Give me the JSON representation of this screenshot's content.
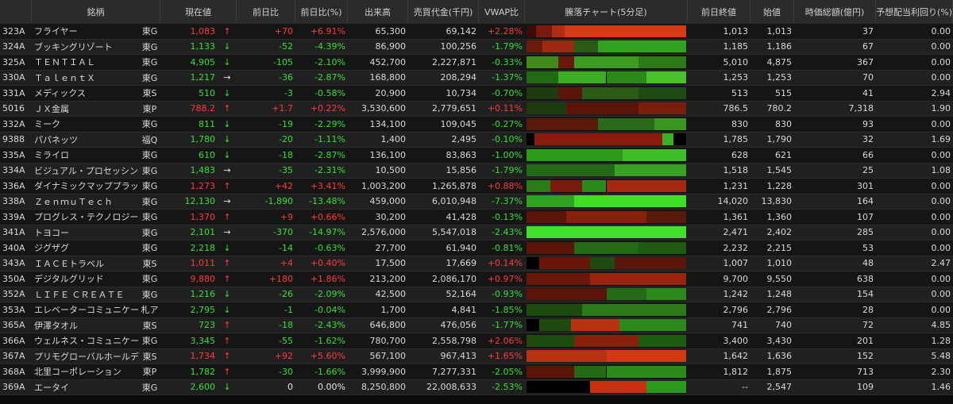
{
  "colors": {
    "up": "#ff3a3a",
    "down": "#34e034",
    "flat": "#e6e6e6"
  },
  "headers": {
    "code": "",
    "name": "銘柄",
    "market": "",
    "price": "現在値",
    "change": "前日比",
    "change_pct": "前日比(%)",
    "volume": "出来高",
    "value": "売買代金(千円)",
    "vwap": "VWAP比",
    "chart": "騰落チャート(5分足)",
    "prev_close": "前日終値",
    "open": "始値",
    "mcap": "時価総額(億円)",
    "yield": "予想配当利回り(%)"
  },
  "rows": [
    {
      "code": "323A",
      "name": "フライヤー",
      "market": "東G",
      "price": "1,083",
      "dir": "up",
      "arrow": "↑",
      "change": "+70",
      "change_pct": "+6.91%",
      "volume": "65,300",
      "value": "69,142",
      "vwap": "+2.28%",
      "prev_close": "1,013",
      "open": "1,013",
      "mcap": "37",
      "yield": "0.00",
      "chart": [
        [
          0,
          0.06,
          "#3b0c07"
        ],
        [
          0.06,
          0.1,
          "#7a1a0e"
        ],
        [
          0.16,
          0.08,
          "#b02c12"
        ],
        [
          0.24,
          1.0,
          "#d63a16"
        ]
      ]
    },
    {
      "code": "324A",
      "name": "ブッキングリゾート",
      "market": "東G",
      "price": "1,133",
      "dir": "down",
      "arrow": "↓",
      "change": "-52",
      "change_pct": "-4.39%",
      "volume": "86,900",
      "value": "100,256",
      "vwap": "-1.79%",
      "prev_close": "1,185",
      "open": "1,186",
      "mcap": "67",
      "yield": "0.00",
      "chart": [
        [
          0,
          0.1,
          "#6a1b0a"
        ],
        [
          0.1,
          0.2,
          "#9a2a10"
        ],
        [
          0.3,
          0.15,
          "#2a5a15"
        ],
        [
          0.45,
          0.55,
          "#2fa21f"
        ]
      ]
    },
    {
      "code": "325A",
      "name": "ＴＥＮＴＩＡＬ",
      "market": "東G",
      "price": "4,905",
      "dir": "down",
      "arrow": "↓",
      "change": "-105",
      "change_pct": "-2.10%",
      "volume": "452,700",
      "value": "2,227,871",
      "vwap": "-0.33%",
      "prev_close": "5,010",
      "open": "4,875",
      "mcap": "367",
      "yield": "0.00",
      "chart": [
        [
          0,
          0.2,
          "#3f8a1b"
        ],
        [
          0.2,
          0.1,
          "#6a1a0a"
        ],
        [
          0.3,
          0.4,
          "#3a9c20"
        ],
        [
          0.7,
          0.3,
          "#2c7a17"
        ]
      ]
    },
    {
      "code": "330A",
      "name": "ＴａｌｅｎｔＸ",
      "market": "東G",
      "price": "1,217",
      "dir": "down",
      "arrow": "→",
      "change": "-36",
      "change_pct": "-2.87%",
      "volume": "168,800",
      "value": "208,294",
      "vwap": "-1.37%",
      "prev_close": "1,253",
      "open": "1,253",
      "mcap": "70",
      "yield": "0.00",
      "chart": [
        [
          0,
          0.2,
          "#1f6a12"
        ],
        [
          0.2,
          0.3,
          "#3cac22"
        ],
        [
          0.5,
          0.25,
          "#2a8a18"
        ],
        [
          0.75,
          0.25,
          "#48c22a"
        ]
      ]
    },
    {
      "code": "331A",
      "name": "メディックス",
      "market": "東S",
      "price": "510",
      "dir": "down",
      "arrow": "↓",
      "change": "-3",
      "change_pct": "-0.58%",
      "volume": "20,900",
      "value": "10,734",
      "vwap": "-0.70%",
      "prev_close": "513",
      "open": "515",
      "mcap": "41",
      "yield": "2.94",
      "chart": [
        [
          0,
          0.2,
          "#1e3a10"
        ],
        [
          0.2,
          0.15,
          "#5a140a"
        ],
        [
          0.35,
          0.35,
          "#2a5c18"
        ],
        [
          0.7,
          0.3,
          "#1f4a12"
        ]
      ]
    },
    {
      "code": "5016",
      "name": "ＪＸ金属",
      "market": "東P",
      "price": "788.2",
      "dir": "up",
      "arrow": "↑",
      "change": "+1.7",
      "change_pct": "+0.22%",
      "volume": "3,530,600",
      "value": "2,779,651",
      "vwap": "+0.11%",
      "prev_close": "786.5",
      "open": "780.2",
      "mcap": "7,318",
      "yield": "1.90",
      "chart": [
        [
          0,
          0.25,
          "#1e3a10"
        ],
        [
          0.25,
          0.45,
          "#5a140a"
        ],
        [
          0.7,
          0.3,
          "#7a1d0c"
        ]
      ]
    },
    {
      "code": "332A",
      "name": "ミーク",
      "market": "東G",
      "price": "811",
      "dir": "down",
      "arrow": "↓",
      "change": "-19",
      "change_pct": "-2.29%",
      "volume": "134,100",
      "value": "109,045",
      "vwap": "-0.27%",
      "prev_close": "830",
      "open": "830",
      "mcap": "93",
      "yield": "0.00",
      "chart": [
        [
          0,
          0.45,
          "#5a1a0a"
        ],
        [
          0.45,
          0.35,
          "#2a6a18"
        ],
        [
          0.8,
          0.2,
          "#3a9420"
        ]
      ]
    },
    {
      "code": "9388",
      "name": "パパネッツ",
      "market": "福Q",
      "price": "1,780",
      "dir": "down",
      "arrow": "↓",
      "change": "-20",
      "change_pct": "-1.11%",
      "volume": "1,400",
      "value": "2,495",
      "vwap": "-0.10%",
      "prev_close": "1,785",
      "open": "1,790",
      "mcap": "32",
      "yield": "1.69",
      "chart": [
        [
          0,
          0.05,
          "#000000"
        ],
        [
          0.05,
          0.8,
          "#8a1a0e"
        ],
        [
          0.85,
          0.07,
          "#3cb025"
        ],
        [
          0.92,
          0.08,
          "#000000"
        ]
      ]
    },
    {
      "code": "335A",
      "name": "ミライロ",
      "market": "東G",
      "price": "610",
      "dir": "down",
      "arrow": "↓",
      "change": "-18",
      "change_pct": "-2.87%",
      "volume": "136,100",
      "value": "83,863",
      "vwap": "-1.00%",
      "prev_close": "628",
      "open": "621",
      "mcap": "66",
      "yield": "0.00",
      "chart": [
        [
          0,
          0.6,
          "#2c9a1c"
        ],
        [
          0.6,
          0.4,
          "#3fbe28"
        ]
      ]
    },
    {
      "code": "334A",
      "name": "ビジュアル・プロセッシング・ジャパン",
      "market": "東G",
      "price": "1,483",
      "dir": "down",
      "arrow": "→",
      "change": "-35",
      "change_pct": "-2.31%",
      "volume": "10,500",
      "value": "15,856",
      "vwap": "-1.79%",
      "prev_close": "1,518",
      "open": "1,545",
      "mcap": "25",
      "yield": "1.08",
      "chart": [
        [
          0,
          0.55,
          "#226a14"
        ],
        [
          0.55,
          0.45,
          "#3aa222"
        ]
      ]
    },
    {
      "code": "336A",
      "name": "ダイナミックマッププラットフォーム",
      "market": "東G",
      "price": "1,273",
      "dir": "up",
      "arrow": "↑",
      "change": "+42",
      "change_pct": "+3.41%",
      "volume": "1,003,200",
      "value": "1,265,878",
      "vwap": "+0.88%",
      "prev_close": "1,231",
      "open": "1,228",
      "mcap": "301",
      "yield": "0.00",
      "chart": [
        [
          0,
          0.15,
          "#2a7a18"
        ],
        [
          0.15,
          0.2,
          "#7a1a0c"
        ],
        [
          0.35,
          0.15,
          "#2a8a1a"
        ],
        [
          0.5,
          0.5,
          "#a8280f"
        ]
      ]
    },
    {
      "code": "338A",
      "name": "ＺｅｎｍｕＴｅｃｈ",
      "market": "東G",
      "price": "12,130",
      "dir": "down",
      "arrow": "→",
      "change": "-1,890",
      "change_pct": "-13.48%",
      "volume": "459,000",
      "value": "6,010,948",
      "vwap": "-7.37%",
      "prev_close": "14,020",
      "open": "13,830",
      "mcap": "164",
      "yield": "0.00",
      "chart": [
        [
          0,
          0.3,
          "#2fa21f"
        ],
        [
          0.3,
          0.7,
          "#3ee022"
        ]
      ]
    },
    {
      "code": "339A",
      "name": "プログレス・テクノロジーズ グループ",
      "market": "東G",
      "price": "1,370",
      "dir": "up",
      "arrow": "↑",
      "change": "+9",
      "change_pct": "+0.66%",
      "volume": "30,200",
      "value": "41,428",
      "vwap": "-0.13%",
      "prev_close": "1,361",
      "open": "1,360",
      "mcap": "107",
      "yield": "0.00",
      "chart": [
        [
          0,
          0.25,
          "#5a140a"
        ],
        [
          0.25,
          0.5,
          "#8a1f0d"
        ],
        [
          0.75,
          0.25,
          "#5a1a0a"
        ]
      ]
    },
    {
      "code": "341A",
      "name": "トヨコー",
      "market": "東G",
      "price": "2,101",
      "dir": "down",
      "arrow": "→",
      "change": "-370",
      "change_pct": "-14.97%",
      "volume": "2,576,000",
      "value": "5,547,018",
      "vwap": "-2.43%",
      "prev_close": "2,471",
      "open": "2,402",
      "mcap": "285",
      "yield": "0.00",
      "chart": [
        [
          0,
          1.0,
          "#3ee22a"
        ]
      ]
    },
    {
      "code": "340A",
      "name": "ジグザグ",
      "market": "東G",
      "price": "2,218",
      "dir": "down",
      "arrow": "↓",
      "change": "-14",
      "change_pct": "-0.63%",
      "volume": "27,700",
      "value": "61,940",
      "vwap": "-0.81%",
      "prev_close": "2,232",
      "open": "2,215",
      "mcap": "53",
      "yield": "0.00",
      "chart": [
        [
          0,
          0.3,
          "#5a140a"
        ],
        [
          0.3,
          0.4,
          "#226a14"
        ],
        [
          0.7,
          0.3,
          "#1e5a10"
        ]
      ]
    },
    {
      "code": "343A",
      "name": "ＩＡＣＥトラベル",
      "market": "東S",
      "price": "1,011",
      "dir": "up",
      "arrow": "↑",
      "change": "+4",
      "change_pct": "+0.40%",
      "volume": "17,500",
      "value": "17,669",
      "vwap": "+0.14%",
      "prev_close": "1,007",
      "open": "1,010",
      "mcap": "48",
      "yield": "2.47",
      "chart": [
        [
          0,
          0.08,
          "#000000"
        ],
        [
          0.08,
          0.32,
          "#6a150a"
        ],
        [
          0.4,
          0.15,
          "#1e4a10"
        ],
        [
          0.55,
          0.45,
          "#5a140a"
        ]
      ]
    },
    {
      "code": "350A",
      "name": "デジタルグリッド",
      "market": "東G",
      "price": "9,880",
      "dir": "up",
      "arrow": "↑",
      "change": "+180",
      "change_pct": "+1.86%",
      "volume": "213,200",
      "value": "2,086,170",
      "vwap": "+0.97%",
      "prev_close": "9,700",
      "open": "9,550",
      "mcap": "638",
      "yield": "0.00",
      "chart": [
        [
          0,
          0.4,
          "#6a170a"
        ],
        [
          0.4,
          0.6,
          "#9a250f"
        ]
      ]
    },
    {
      "code": "352A",
      "name": "ＬＩＦＥ ＣＲＥＡＴＥ",
      "market": "東G",
      "price": "1,216",
      "dir": "down",
      "arrow": "↓",
      "change": "-26",
      "change_pct": "-2.09%",
      "volume": "42,500",
      "value": "52,164",
      "vwap": "-0.93%",
      "prev_close": "1,242",
      "open": "1,248",
      "mcap": "154",
      "yield": "0.00",
      "chart": [
        [
          0,
          0.5,
          "#5a140a"
        ],
        [
          0.5,
          0.25,
          "#226a14"
        ],
        [
          0.75,
          0.25,
          "#2a8a18"
        ]
      ]
    },
    {
      "code": "353A",
      "name": "エレベーターコミュニケーションズ",
      "market": "札ア",
      "price": "2,795",
      "dir": "down",
      "arrow": "↓",
      "change": "-1",
      "change_pct": "-0.04%",
      "volume": "1,700",
      "value": "4,841",
      "vwap": "-1.85%",
      "prev_close": "2,796",
      "open": "2,796",
      "mcap": "28",
      "yield": "0.00",
      "chart": [
        [
          0,
          0.35,
          "#1e4a10"
        ],
        [
          0.35,
          0.65,
          "#2a7a18"
        ]
      ]
    },
    {
      "code": "365A",
      "name": "伊澤タオル",
      "market": "東S",
      "price": "723",
      "dir": "down",
      "arrow": "↑",
      "change": "-18",
      "change_pct": "-2.43%",
      "volume": "646,800",
      "value": "476,056",
      "vwap": "-1.77%",
      "prev_close": "741",
      "open": "740",
      "mcap": "72",
      "yield": "4.85",
      "chart": [
        [
          0,
          0.08,
          "#000000"
        ],
        [
          0.08,
          0.2,
          "#1e4a10"
        ],
        [
          0.28,
          0.3,
          "#b8320f"
        ],
        [
          0.58,
          0.42,
          "#2a8a1a"
        ]
      ]
    },
    {
      "code": "366A",
      "name": "ウェルネス・コミュニケーションズ",
      "market": "東G",
      "price": "3,345",
      "dir": "down",
      "arrow": "↑",
      "change": "-55",
      "change_pct": "-1.62%",
      "volume": "780,700",
      "value": "2,558,798",
      "vwap": "+2.06%",
      "prev_close": "3,400",
      "open": "3,430",
      "mcap": "201",
      "yield": "1.28",
      "chart": [
        [
          0,
          0.3,
          "#1e4a10"
        ],
        [
          0.3,
          0.4,
          "#8a1f0d"
        ],
        [
          0.7,
          0.3,
          "#1e5a10"
        ]
      ]
    },
    {
      "code": "367A",
      "name": "プリモグローバルホールディングス",
      "market": "東S",
      "price": "1,734",
      "dir": "up",
      "arrow": "↑",
      "change": "+92",
      "change_pct": "+5.60%",
      "volume": "567,100",
      "value": "967,413",
      "vwap": "+1.65%",
      "prev_close": "1,642",
      "open": "1,636",
      "mcap": "152",
      "yield": "5.48",
      "chart": [
        [
          0,
          0.5,
          "#b8320f"
        ],
        [
          0.5,
          0.5,
          "#d33a14"
        ]
      ]
    },
    {
      "code": "368A",
      "name": "北里コーポレーション",
      "market": "東P",
      "price": "1,782",
      "dir": "down",
      "arrow": "↑",
      "change": "-30",
      "change_pct": "-1.66%",
      "volume": "3,999,900",
      "value": "7,277,331",
      "vwap": "-2.05%",
      "prev_close": "1,812",
      "open": "1,875",
      "mcap": "713",
      "yield": "2.30",
      "chart": [
        [
          0,
          0.3,
          "#5a140a"
        ],
        [
          0.3,
          0.2,
          "#226a14"
        ],
        [
          0.5,
          0.5,
          "#2a8a1a"
        ]
      ]
    },
    {
      "code": "369A",
      "name": "エータイ",
      "market": "東G",
      "price": "2,600",
      "dir": "down",
      "arrow": "↓",
      "change": "0",
      "change_pct": "0.00%",
      "volume": "8,250,800",
      "value": "22,008,633",
      "vwap": "-2.53%",
      "prev_close": "--",
      "open": "2,547",
      "mcap": "109",
      "yield": "1.46",
      "chart": [
        [
          0,
          0.4,
          "#000000"
        ],
        [
          0.4,
          0.35,
          "#c8300f"
        ],
        [
          0.75,
          0.25,
          "#2a9a1c"
        ]
      ]
    }
  ]
}
